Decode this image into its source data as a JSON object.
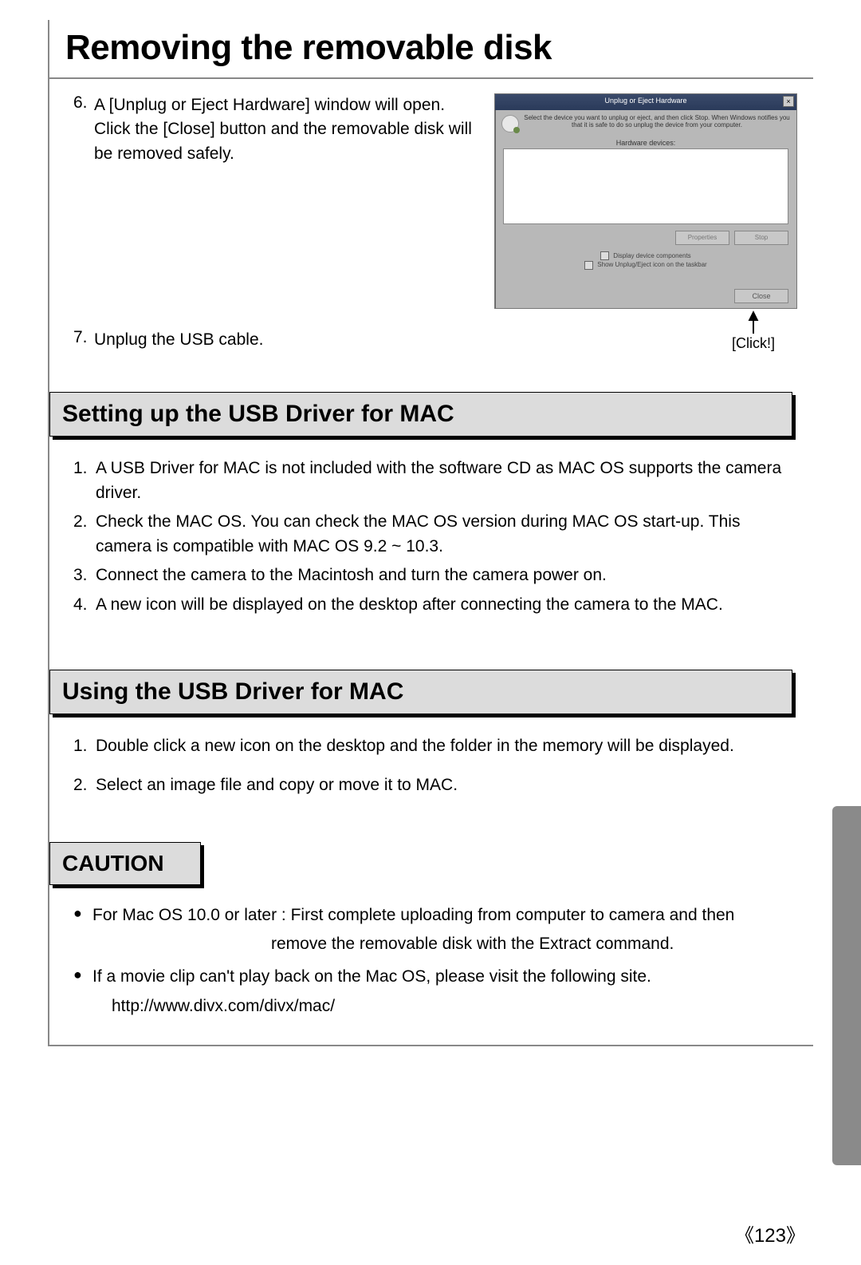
{
  "page_title": "Removing the removable disk",
  "steps_a": [
    {
      "num": "6.",
      "text": "A [Unplug or Eject Hardware] window will open. Click the [Close] button and the removable disk will be removed safely."
    }
  ],
  "steps_b": [
    {
      "num": "7.",
      "text": "Unplug the USB cable."
    }
  ],
  "screenshot": {
    "titlebar": "Unplug or Eject Hardware",
    "close_x": "×",
    "desc": "Select the device you want to unplug or eject, and then click Stop. When Windows notifies you that it is safe to do so unplug the device from your computer.",
    "list_label": "Hardware devices:",
    "btn1": "Properties",
    "btn2": "Stop",
    "check1": "Display device components",
    "check2": "Show Unplug/Eject icon on the taskbar",
    "close_btn": "Close",
    "arrow_label": "[Click!]"
  },
  "section1": {
    "heading": "Setting up the USB Driver for MAC",
    "items": [
      {
        "num": "1.",
        "text": "A USB Driver for MAC is not included with the software CD as MAC OS supports the camera driver."
      },
      {
        "num": "2.",
        "text": "Check the MAC OS. You can check the MAC OS version during MAC OS start-up. This camera is compatible with MAC OS 9.2 ~ 10.3."
      },
      {
        "num": "3.",
        "text": "Connect the camera to the Macintosh and turn the camera power on."
      },
      {
        "num": "4.",
        "text": "A new icon will be displayed on the desktop after connecting the camera to the MAC."
      }
    ]
  },
  "section2": {
    "heading": "Using the USB Driver for MAC",
    "items": [
      {
        "num": "1.",
        "text": "Double click a new icon on the desktop and the folder in the memory will be displayed."
      },
      {
        "num": "2.",
        "text": "Select an image file and copy or move it to MAC."
      }
    ]
  },
  "caution": {
    "heading": "CAUTION",
    "bullets": [
      {
        "line1": "For Mac OS 10.0 or later : First complete uploading from computer to camera and then",
        "line2_indent": "remove the removable disk with the Extract command."
      },
      {
        "line1": "If a movie clip can't play back on the Mac OS, please visit the following site.",
        "line2": "http://www.divx.com/divx/mac/"
      }
    ]
  },
  "page_number": "123"
}
